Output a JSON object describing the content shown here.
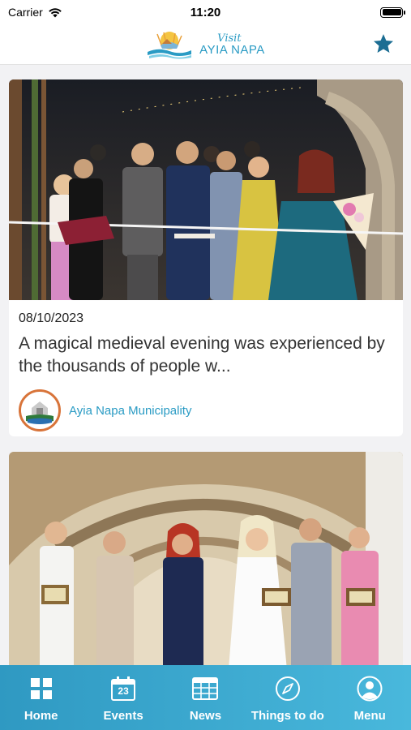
{
  "status_bar": {
    "carrier": "Carrier",
    "time": "11:20"
  },
  "header": {
    "logo_visit": "Visit",
    "logo_name": "AYIA NAPA",
    "favorites_icon": "star-icon",
    "accent_color": "#2a9bc4"
  },
  "feed": {
    "items": [
      {
        "date": "08/10/2023",
        "title": "A magical medieval evening was experienced by the thousands of people w...",
        "source": "Ayia Napa Municipality"
      }
    ]
  },
  "tab_bar": {
    "tabs": [
      {
        "label": "Home",
        "icon": "grid-icon"
      },
      {
        "label": "Events",
        "icon": "calendar-icon",
        "icon_number": "23"
      },
      {
        "label": "News",
        "icon": "news-icon"
      },
      {
        "label": "Things to do",
        "icon": "compass-icon"
      },
      {
        "label": "Menu",
        "icon": "user-icon"
      }
    ]
  }
}
